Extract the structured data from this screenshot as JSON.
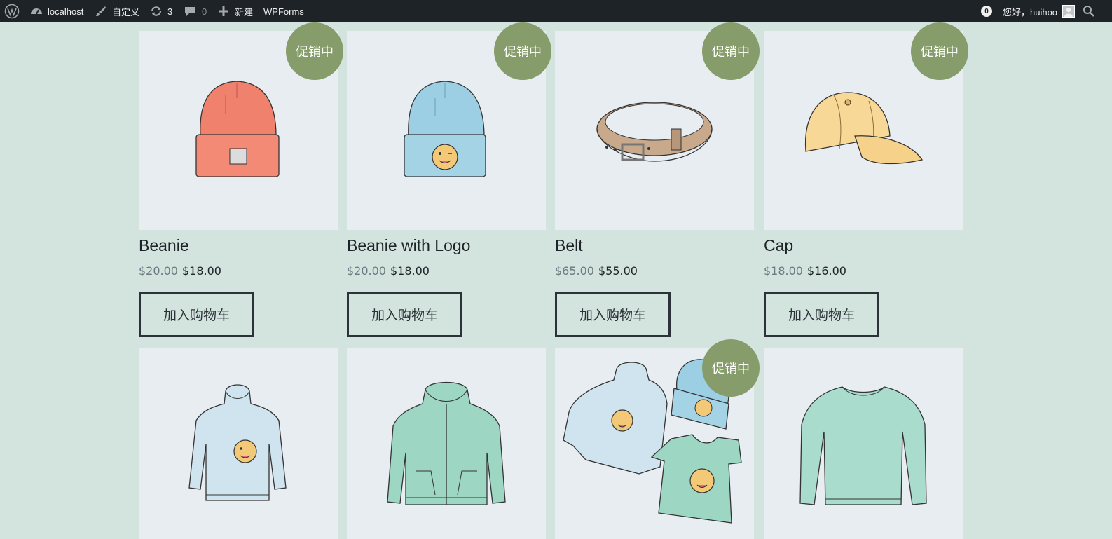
{
  "adminbar": {
    "wp_logo_icon": "wordpress-logo-icon",
    "site_name": "localhost",
    "customize_label": "自定义",
    "updates_count": "3",
    "comments_count": "0",
    "new_label": "新建",
    "wpforms_label": "WPForms",
    "notification_count": "0",
    "greeting": "您好，huihoo"
  },
  "sale_badge": "促销中",
  "add_to_cart": "加入购物车",
  "colors": {
    "page_bg": "#d3e4de",
    "adminbar_bg": "#1d2327",
    "sale_badge_bg": "#869c6a",
    "thumb_bg": "#e8edf1"
  },
  "products": [
    {
      "title": "Beanie",
      "old_price": "$20.00",
      "price": "$18.00",
      "on_sale": true,
      "image": "red-beanie"
    },
    {
      "title": "Beanie with Logo",
      "old_price": "$20.00",
      "price": "$18.00",
      "on_sale": true,
      "image": "blue-beanie-logo"
    },
    {
      "title": "Belt",
      "old_price": "$65.00",
      "price": "$55.00",
      "on_sale": true,
      "image": "brown-belt"
    },
    {
      "title": "Cap",
      "old_price": "$18.00",
      "price": "$16.00",
      "on_sale": true,
      "image": "yellow-cap"
    },
    {
      "on_sale": false,
      "image": "light-blue-hoodie-logo"
    },
    {
      "on_sale": false,
      "image": "green-zip-hoodie"
    },
    {
      "on_sale": true,
      "image": "hoodie-beanie-tshirt-bundle"
    },
    {
      "on_sale": false,
      "image": "green-long-sleeve"
    }
  ]
}
